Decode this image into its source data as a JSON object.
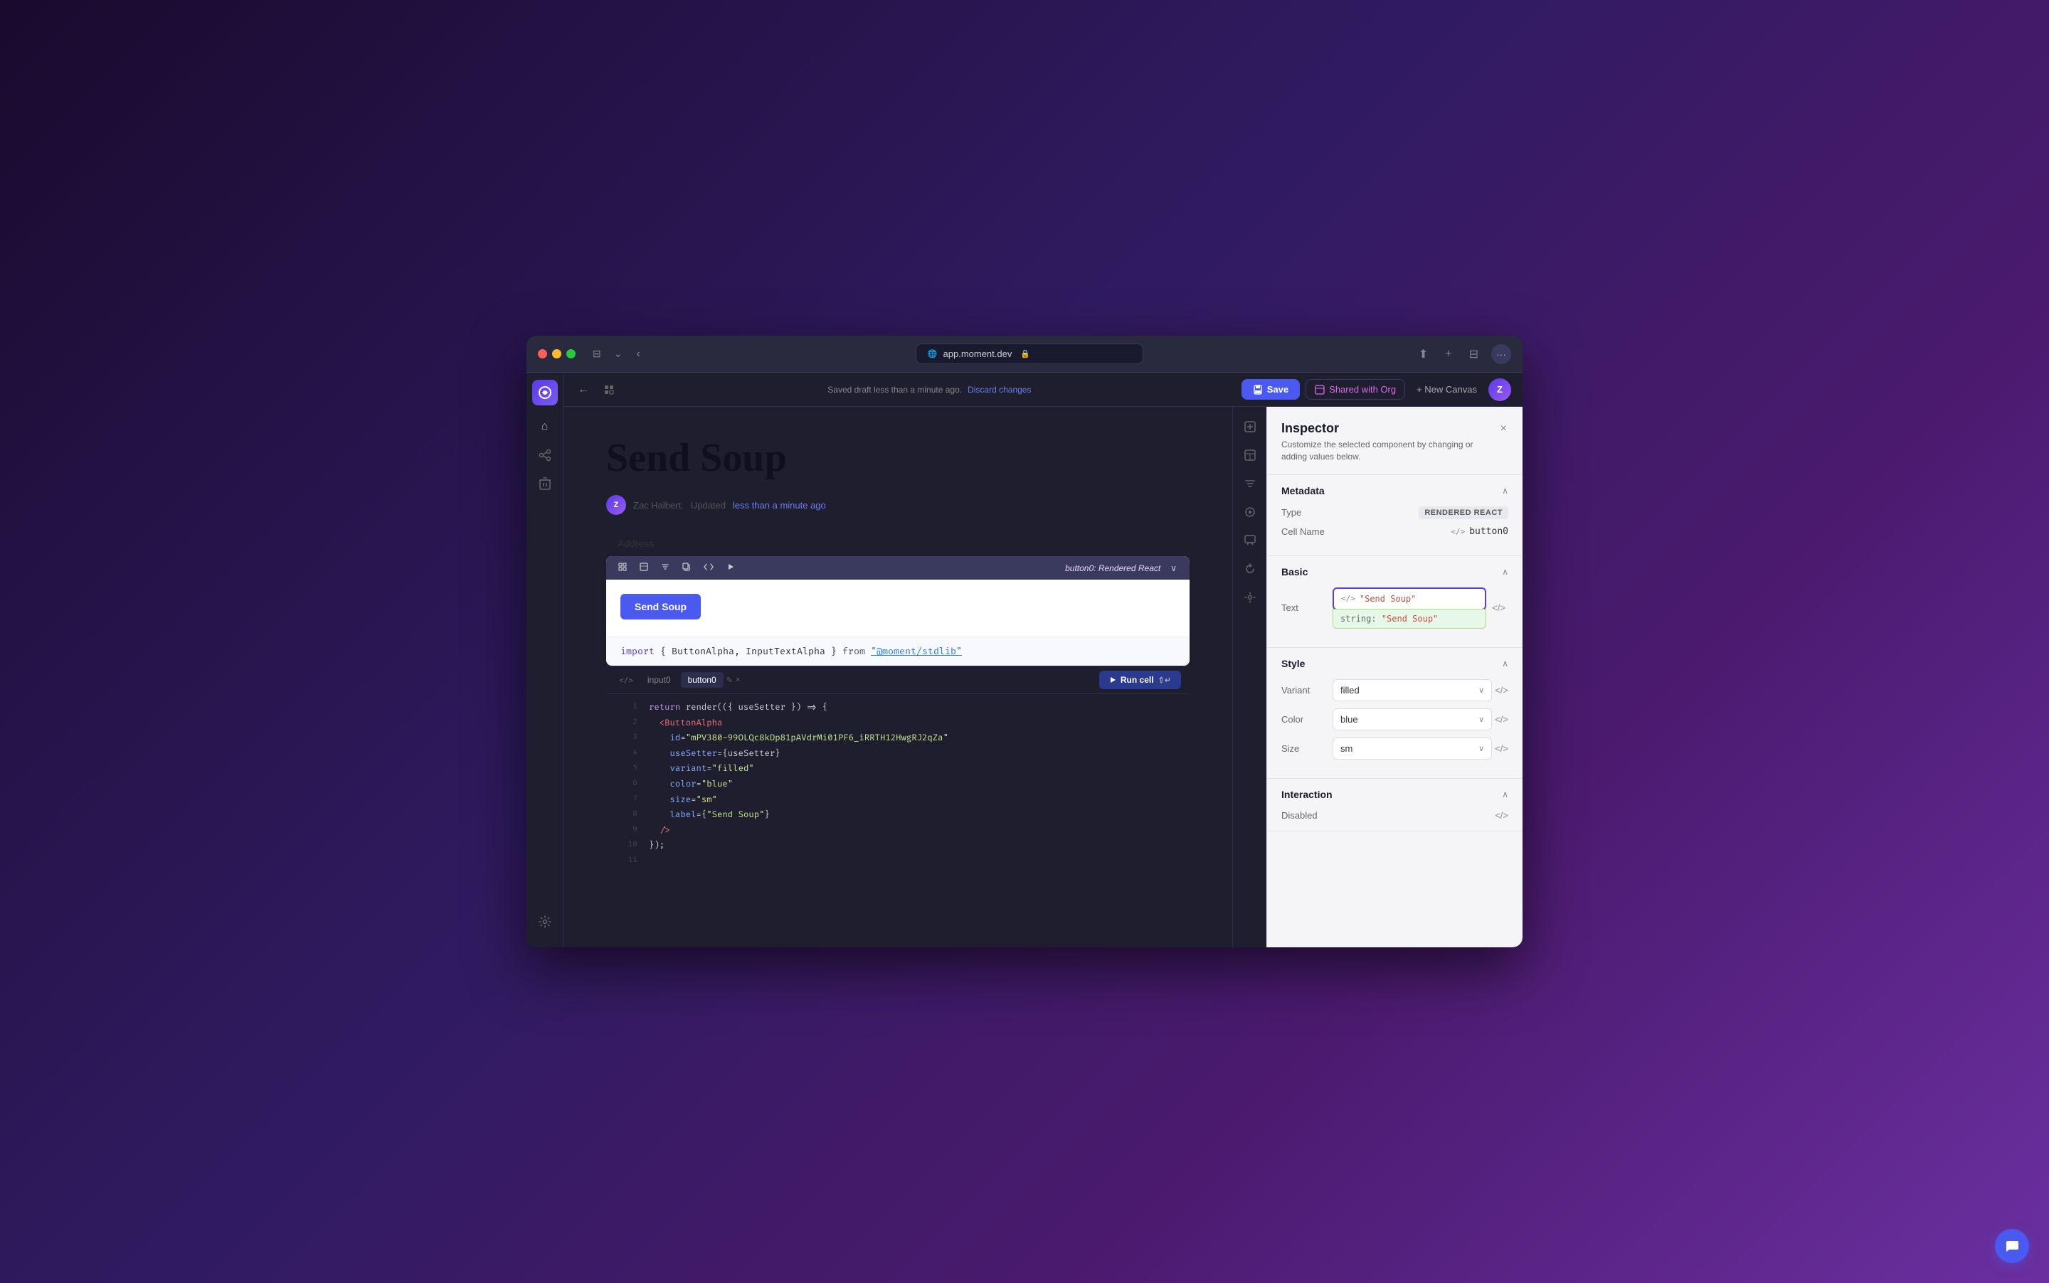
{
  "browser": {
    "url": "app.moment.dev",
    "url_icon": "🔒"
  },
  "topbar": {
    "saved_status": "Saved draft less than a minute ago.",
    "discard_label": "Discard changes",
    "save_label": "Save",
    "shared_label": "Shared with Org",
    "new_canvas_label": "+ New  Canvas",
    "avatar_label": "Z"
  },
  "canvas": {
    "title": "Send Soup",
    "author_name": "Zac Halbert.",
    "updated_prefix": "Updated",
    "updated_link": "less than a minute ago",
    "address_label": "Address",
    "cell_toolbar": {
      "name": "button0: Rendered React"
    },
    "preview_button": "Send Soup",
    "import_line": "import { ButtonAlpha, InputTextAlpha } from \"@moment/stdlib\""
  },
  "code": {
    "tabs": [
      "input0",
      "button0"
    ],
    "active_tab": "button0",
    "run_label": "Run cell",
    "lines": [
      {
        "num": 1,
        "text": "return render(({ useSetter }) => {"
      },
      {
        "num": 2,
        "text": "  <ButtonAlpha"
      },
      {
        "num": 3,
        "text": "    id=\"mPV380-99OLQc8kDp81pAVdrMi01PF6_iRRTH12HwgRJ2qZa\""
      },
      {
        "num": 4,
        "text": "    useSetter={useSetter}"
      },
      {
        "num": 5,
        "text": "    variant=\"filled\""
      },
      {
        "num": 6,
        "text": "    color=\"blue\""
      },
      {
        "num": 7,
        "text": "    size=\"sm\""
      },
      {
        "num": 8,
        "text": "    label={\"Send Soup\"}"
      },
      {
        "num": 9,
        "text": "  />"
      },
      {
        "num": 10,
        "text": "});"
      },
      {
        "num": 11,
        "text": ""
      }
    ]
  },
  "inspector": {
    "title": "Inspector",
    "description": "Customize the selected component by changing or adding values below.",
    "sections": {
      "metadata": {
        "title": "Metadata",
        "type_label": "Type",
        "type_value": "RENDERED REACT",
        "cell_name_label": "Cell Name",
        "cell_name_value": "button0"
      },
      "basic": {
        "title": "Basic",
        "text_label": "Text",
        "text_field_tag": "</>",
        "text_field_val": "\"Send Soup\"",
        "text_string_key": "string:",
        "text_string_val": "\"Send Soup\""
      },
      "style": {
        "title": "Style",
        "variant_label": "Variant",
        "variant_value": "filled",
        "color_label": "Color",
        "color_value": "blue",
        "size_label": "Size",
        "size_value": "sm"
      },
      "interaction": {
        "title": "Interaction",
        "disabled_label": "Disabled"
      }
    }
  },
  "icons": {
    "sidebar_logo": "✦",
    "home": "⌂",
    "graph": "⎇",
    "trash": "🗑",
    "settings": "⚙",
    "back_arrow": "←",
    "filter": "⚙",
    "table": "⊞",
    "bubble": "💬",
    "star": "★",
    "history": "⟳",
    "component": "⊕",
    "toggle_panel": "⊡",
    "close": "×",
    "chevron_up": "∧",
    "chevron_down": "∨",
    "code_tag": "</>",
    "play": "▶",
    "format_text": "T",
    "format_code": "<>",
    "format_align": "≡",
    "format_grid": "⊞",
    "format_run": "▷"
  }
}
